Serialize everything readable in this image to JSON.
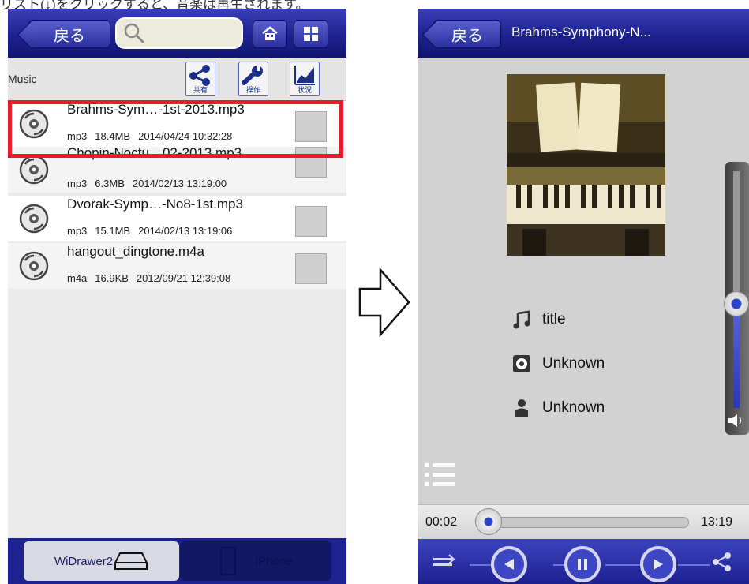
{
  "caption": "リスト(↓)をクリックすると、音楽は再生されます。",
  "left_screen": {
    "header": {
      "back_label": "戻る"
    },
    "subbar": {
      "title": "Music",
      "tools": [
        {
          "label": "共有",
          "icon": "share-icon"
        },
        {
          "label": "操作",
          "icon": "wrench-icon"
        },
        {
          "label": "状況",
          "icon": "chart-icon"
        }
      ]
    },
    "files": [
      {
        "name": "Brahms-Sym…-1st-2013.mp3",
        "type": "mp3",
        "size": "18.4MB",
        "date": "2014/04/24 10:32:28"
      },
      {
        "name": "Chopin-Noctu…02-2013.mp3",
        "type": "mp3",
        "size": "6.3MB",
        "date": "2014/02/13 13:19:00"
      },
      {
        "name": "Dvorak-Symp…-No8-1st.mp3",
        "type": "mp3",
        "size": "15.1MB",
        "date": "2014/02/13 13:19:06"
      },
      {
        "name": "hangout_dingtone.m4a",
        "type": "m4a",
        "size": "16.9KB",
        "date": "2012/09/21 12:39:08"
      }
    ],
    "footer": {
      "tab_wi": "WiDrawer2",
      "tab_iphone": "iPhone"
    }
  },
  "right_screen": {
    "header": {
      "back_label": "戻る",
      "title": "Brahms-Symphony-N..."
    },
    "track_title": "title",
    "album": "Unknown",
    "artist": "Unknown",
    "current_time": "00:02",
    "duration": "13:19",
    "progress_fraction": 0.02,
    "volume_fraction": 0.45
  },
  "colors": {
    "header_blue": "#1d2190",
    "highlight_red": "#ea1b2a"
  }
}
